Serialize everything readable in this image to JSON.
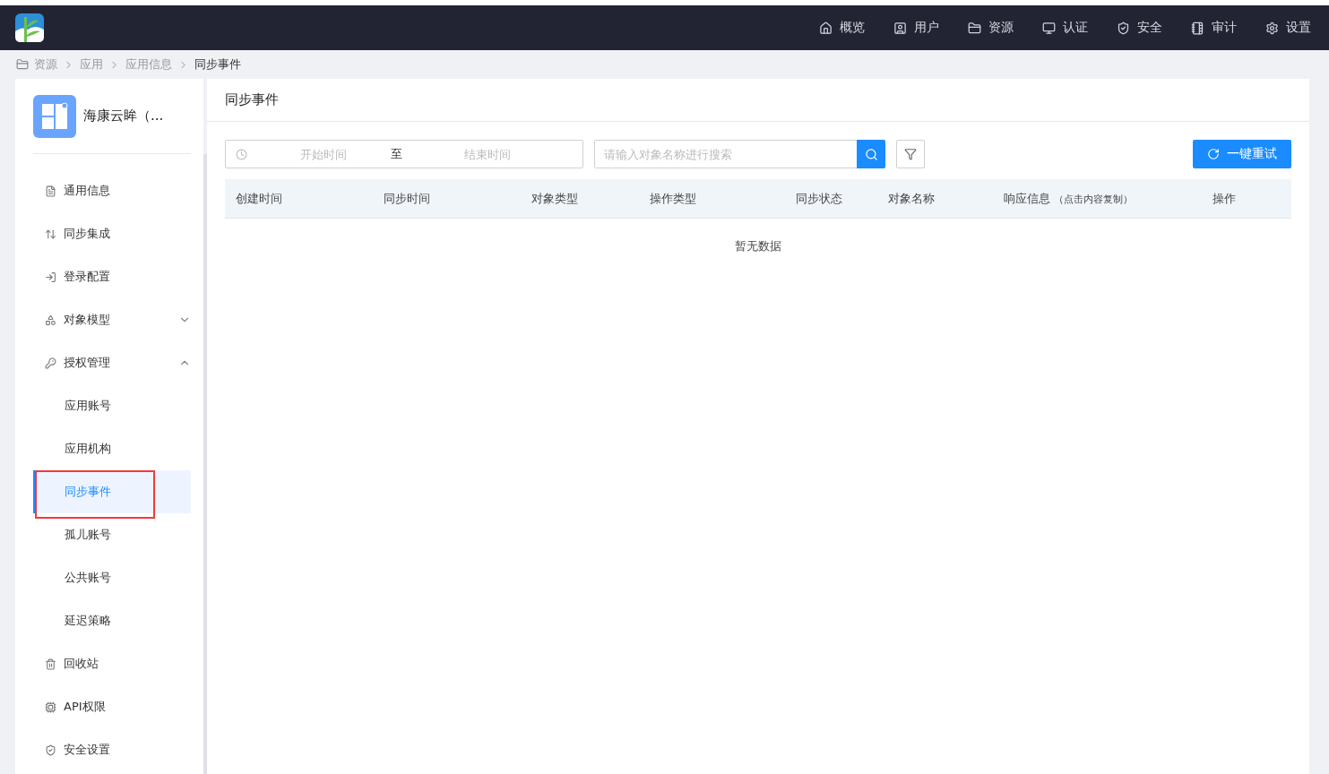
{
  "top_nav": [
    {
      "label": "概览"
    },
    {
      "label": "用户"
    },
    {
      "label": "资源"
    },
    {
      "label": "认证"
    },
    {
      "label": "安全"
    },
    {
      "label": "审计"
    },
    {
      "label": "设置"
    }
  ],
  "breadcrumb": [
    "资源",
    "应用",
    "应用信息",
    "同步事件"
  ],
  "app": {
    "name": "海康云眸（..."
  },
  "sidebar": {
    "items": [
      {
        "label": "通用信息"
      },
      {
        "label": "同步集成"
      },
      {
        "label": "登录配置"
      },
      {
        "label": "对象模型",
        "expanded": false
      },
      {
        "label": "授权管理",
        "expanded": true,
        "children": [
          {
            "label": "应用账号",
            "selected": false
          },
          {
            "label": "应用机构",
            "selected": false
          },
          {
            "label": "同步事件",
            "selected": true
          },
          {
            "label": "孤儿账号",
            "selected": false
          },
          {
            "label": "公共账号",
            "selected": false
          },
          {
            "label": "延迟策略",
            "selected": false
          }
        ]
      },
      {
        "label": "回收站"
      },
      {
        "label": "API权限"
      },
      {
        "label": "安全设置"
      }
    ]
  },
  "page": {
    "title": "同步事件",
    "date_range": {
      "start_placeholder": "开始时间",
      "separator": "至",
      "end_placeholder": "结束时间"
    },
    "search": {
      "placeholder": "请输入对象名称进行搜索"
    },
    "retry_button": "一键重试",
    "table": {
      "columns": [
        {
          "label": "创建时间"
        },
        {
          "label": "同步时间"
        },
        {
          "label": "对象类型"
        },
        {
          "label": "操作类型"
        },
        {
          "label": "同步状态"
        },
        {
          "label": "对象名称"
        },
        {
          "label": "响应信息",
          "note": "（点击内容复制）"
        },
        {
          "label": "操作"
        }
      ],
      "empty_text": "暂无数据"
    }
  }
}
